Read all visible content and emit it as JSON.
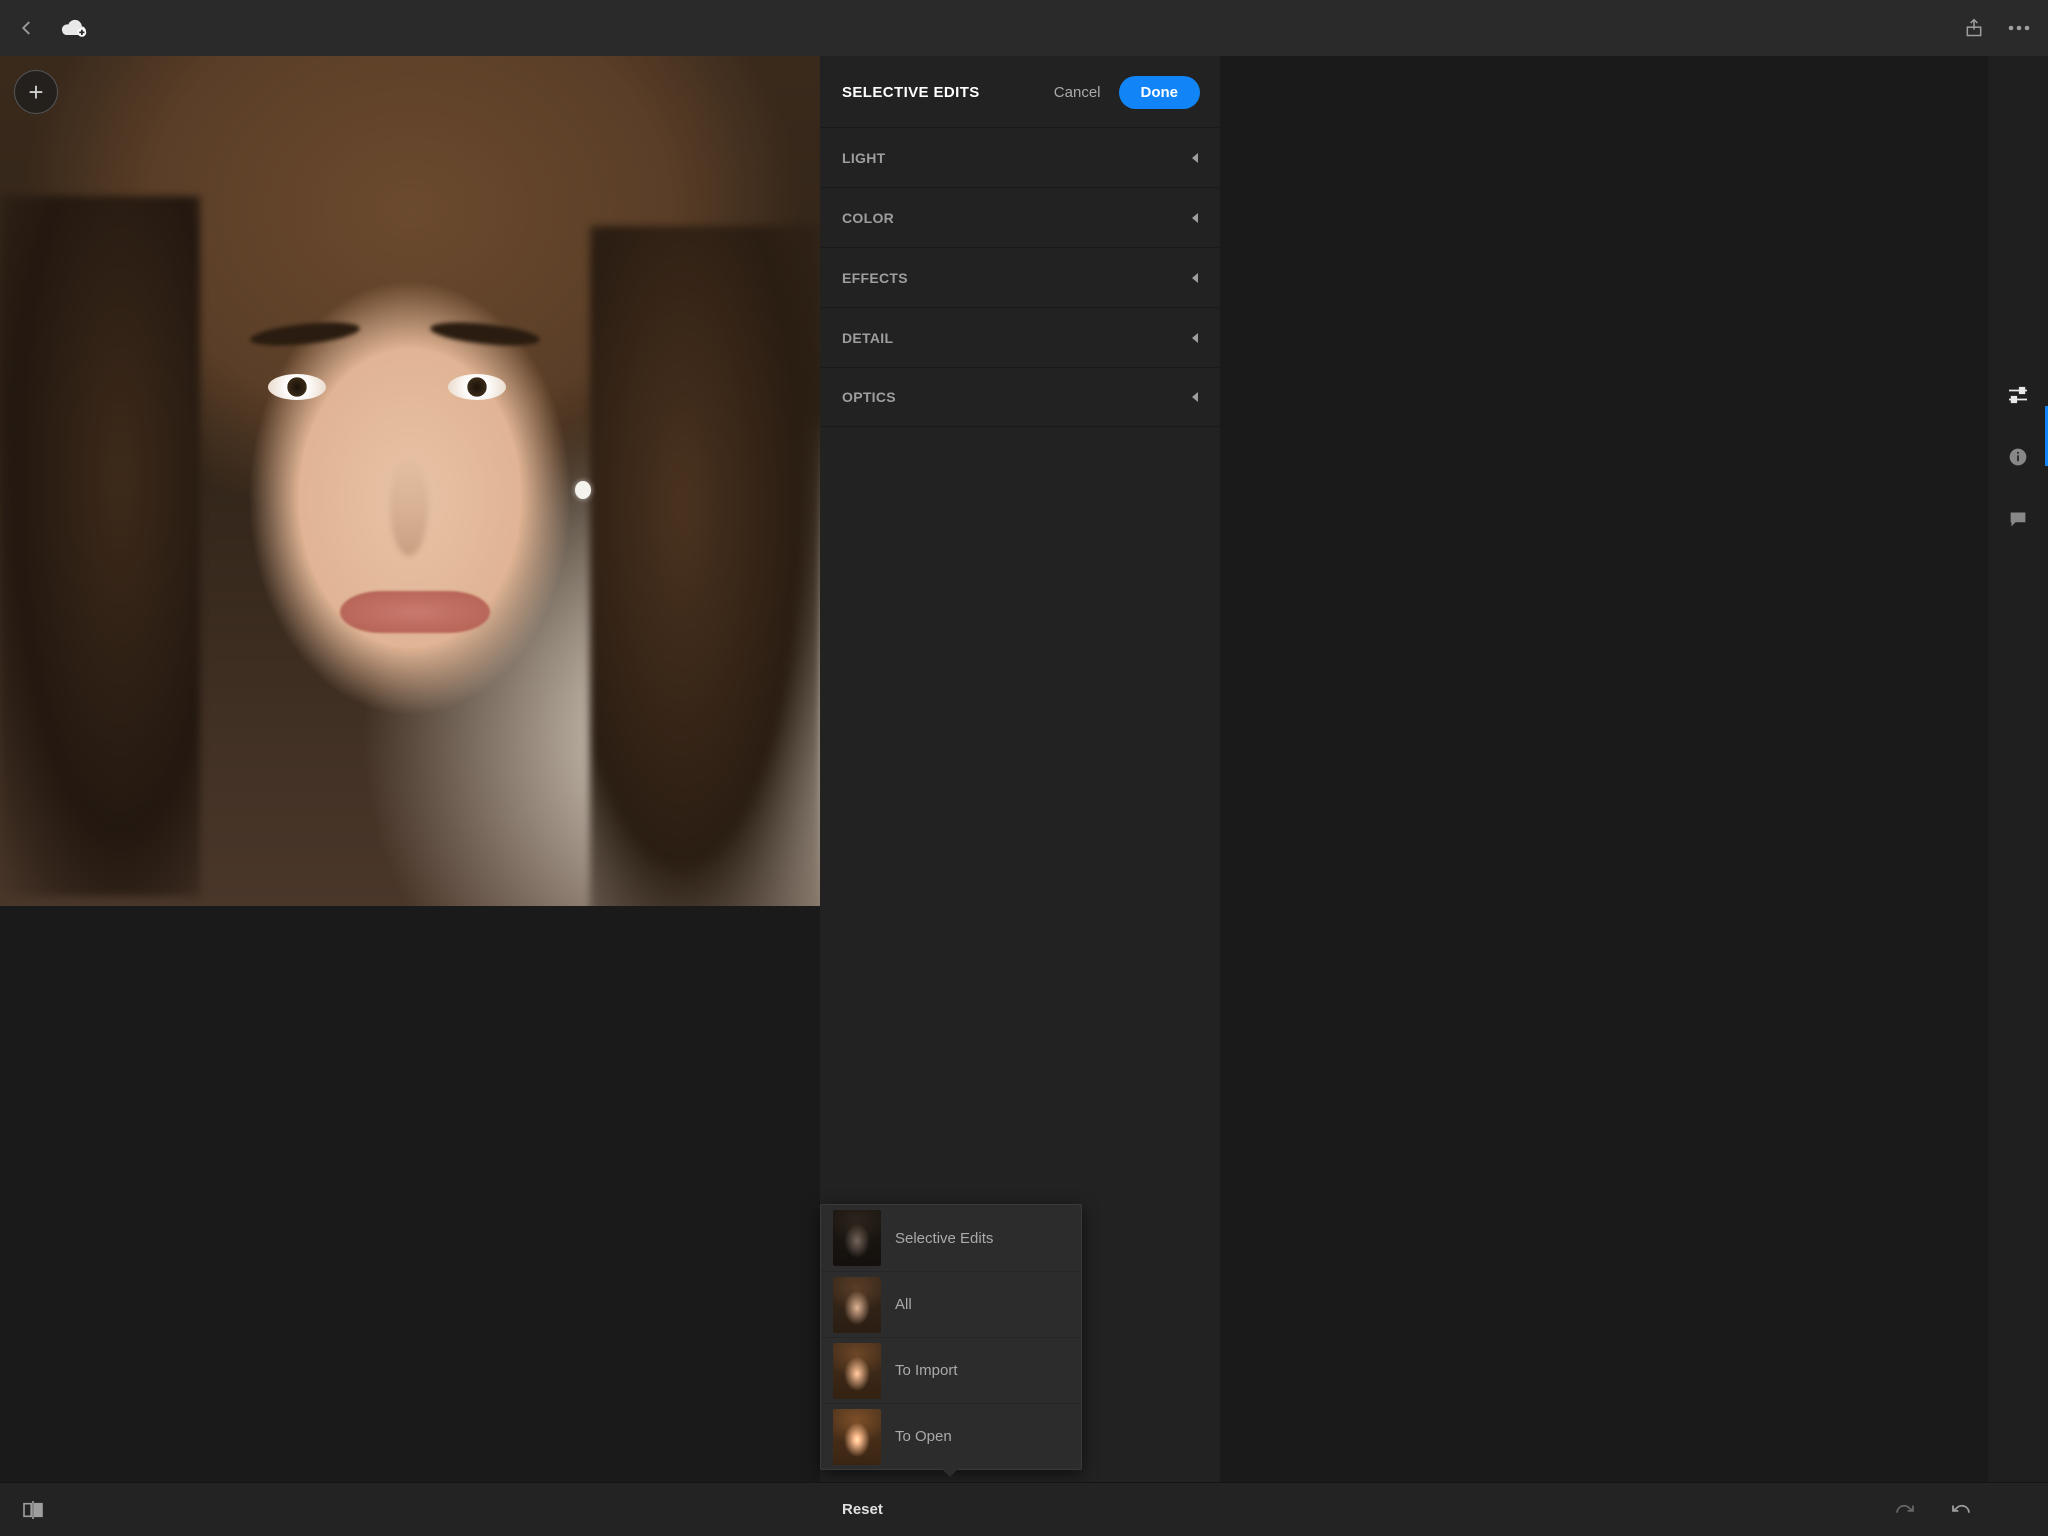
{
  "header": {
    "back_icon": "back",
    "cloud_icon": "cloud-add",
    "share_icon": "share",
    "more_icon": "more"
  },
  "canvas": {
    "add_tooltip": "+"
  },
  "panel": {
    "title": "SELECTIVE EDITS",
    "cancel_label": "Cancel",
    "done_label": "Done",
    "sections": [
      {
        "label": "LIGHT"
      },
      {
        "label": "COLOR"
      },
      {
        "label": "EFFECTS"
      },
      {
        "label": "DETAIL"
      },
      {
        "label": "OPTICS"
      }
    ]
  },
  "popup": {
    "items": [
      {
        "label": "Selective Edits"
      },
      {
        "label": "All"
      },
      {
        "label": "To Import"
      },
      {
        "label": "To Open"
      }
    ]
  },
  "rail": {
    "adjust_icon": "sliders",
    "info_icon": "info",
    "comment_icon": "comment"
  },
  "bottom": {
    "compare_icon": "before-after",
    "reset_label": "Reset",
    "redo_icon": "redo",
    "undo_icon": "undo"
  }
}
